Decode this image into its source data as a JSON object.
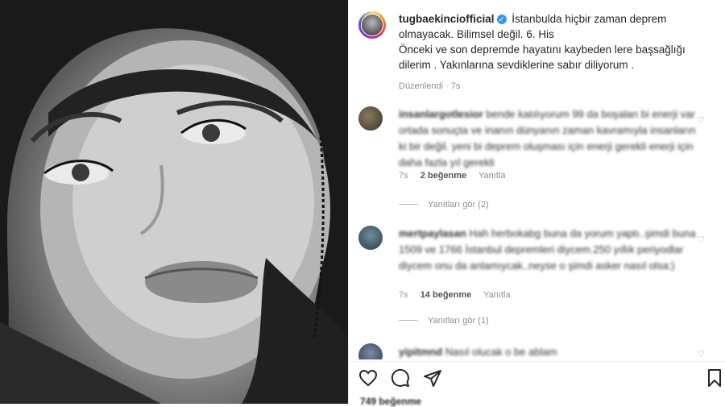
{
  "post": {
    "username": "tugbaekincіofficial",
    "verified_mark": "✓",
    "caption_line1": "İstanbulda hiçbir zaman deprem olmayacak. Bilimsel değil. 6. His",
    "caption_line2": "Önceki ve son depremde hayatını kaybeden lere başsağlığı dilerim . Yakınlarına sevdiklerine sabır diliyorum .",
    "edited": "Düzenlendi · 7s"
  },
  "comments": [
    {
      "username": "insanlargotlesior",
      "text": "bende katılıyorum 99 da boşalan bi enerji var ortada sonuçta ve inanın dünyanın zaman kavramıyla insanların ki bir değil. yeni bi deprem oluşması için enerji gerekli enerji için daha fazla yıl gerekli",
      "time": "7s",
      "likes": "2 beğenme",
      "reply": "Yanıtla",
      "view_replies": "Yanıtları gör (2)"
    },
    {
      "username": "mertpaylasan",
      "text": "Hah herbokabg buna da yorum yaptı..şimdi buna 1509 ve 1766 İstanbul depremleri diycem.250 yıllık periyodlar diycem onu da anlamıycak..neyse o şimdi asker nasıl olsa:)",
      "time": "7s",
      "likes": "14 beğenme",
      "reply": "Yanıtla",
      "view_replies": "Yanıtları gör (1)"
    },
    {
      "username": "yipitmnd",
      "text": "Nasıl olucak o be ablam"
    }
  ],
  "actions": {
    "like_icon": "heart-outline",
    "comment_icon": "speech-bubble",
    "share_icon": "paper-plane",
    "save_icon": "bookmark-outline"
  },
  "likes_count": "749 beğenme",
  "colors": {
    "verified": "#3897f0",
    "muted": "#8e8e8e"
  }
}
